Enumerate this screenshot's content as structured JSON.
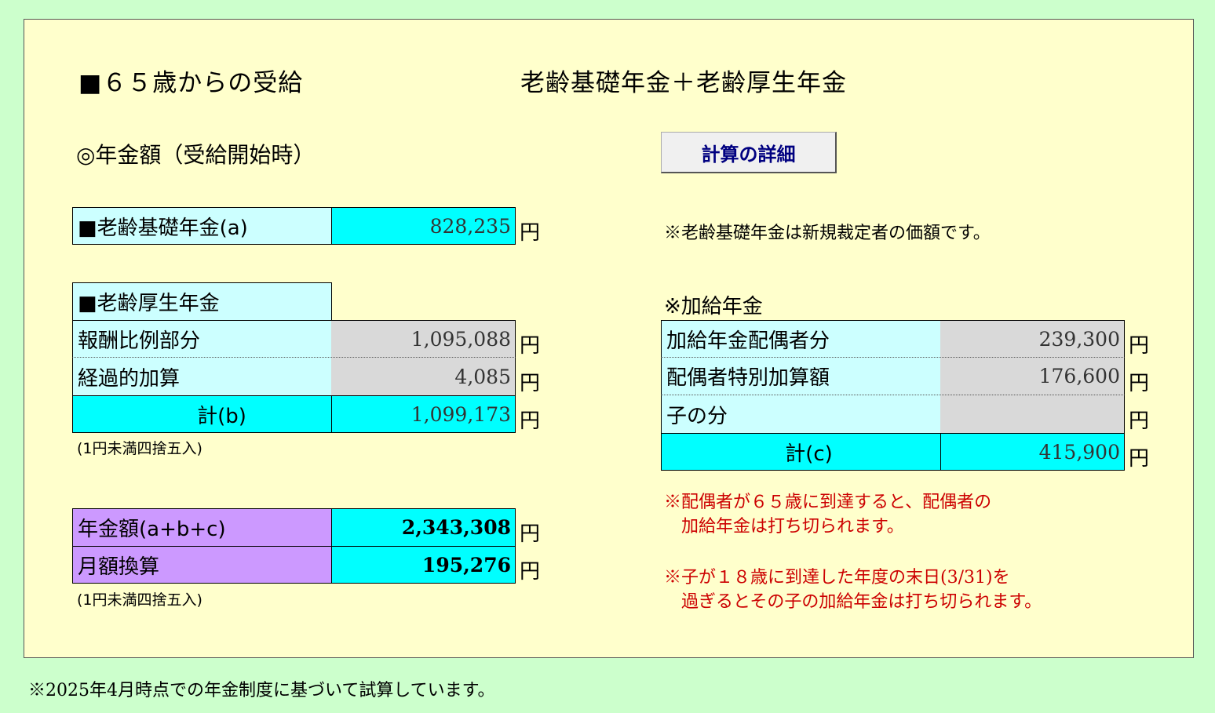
{
  "header": {
    "title": "■６５歳からの受給",
    "subtitle": "老齢基礎年金＋老齢厚生年金"
  },
  "section": {
    "heading": "◎年金額（受給開始時）"
  },
  "button": {
    "detail_label": "計算の詳細"
  },
  "basic_pension": {
    "label": "■老齢基礎年金(a)",
    "value": "828,235",
    "unit": "円",
    "note": "※老齢基礎年金は新規裁定者の価額です。"
  },
  "employee_pension": {
    "header": "■老齢厚生年金",
    "rows": [
      {
        "label": "報酬比例部分",
        "value": "1,095,088",
        "unit": "円"
      },
      {
        "label": "経過的加算",
        "value": "4,085",
        "unit": "円"
      }
    ],
    "total": {
      "label": "計(b)",
      "value": "1,099,173",
      "unit": "円"
    },
    "rounding_note": "(1円未満四捨五入)"
  },
  "additional_pension": {
    "header": "※加給年金",
    "rows": [
      {
        "label": "加給年金配偶者分",
        "value": "239,300",
        "unit": "円"
      },
      {
        "label": "配偶者特別加算額",
        "value": "176,600",
        "unit": "円"
      },
      {
        "label": "子の分",
        "value": "",
        "unit": "円"
      }
    ],
    "total": {
      "label": "計(c)",
      "value": "415,900",
      "unit": "円"
    },
    "notes": [
      "※配偶者が６５歳に到達すると、配偶者の",
      "　加給年金は打ち切られます。",
      "※子が１８歳に到達した年度の末日(3/31)を",
      "　過ぎるとその子の加給年金は打ち切られます。"
    ]
  },
  "summary": {
    "rows": [
      {
        "label": "年金額(a+b+c)",
        "value": "2,343,308",
        "unit": "円"
      },
      {
        "label": "月額換算",
        "value": "195,276",
        "unit": "円"
      }
    ],
    "rounding_note": "(1円未満四捨五入)"
  },
  "footer": {
    "note": "※2025年4月時点での年金制度に基づいて試算しています。"
  },
  "colors": {
    "page_bg": "#ccffcc",
    "panel_bg": "#ffffcc",
    "cyan": "#00ffff",
    "light_cyan": "#ccffff",
    "grey": "#d9d9d9",
    "purple": "#cc99ff",
    "red_note": "#cc0000",
    "button_text": "#000080"
  }
}
